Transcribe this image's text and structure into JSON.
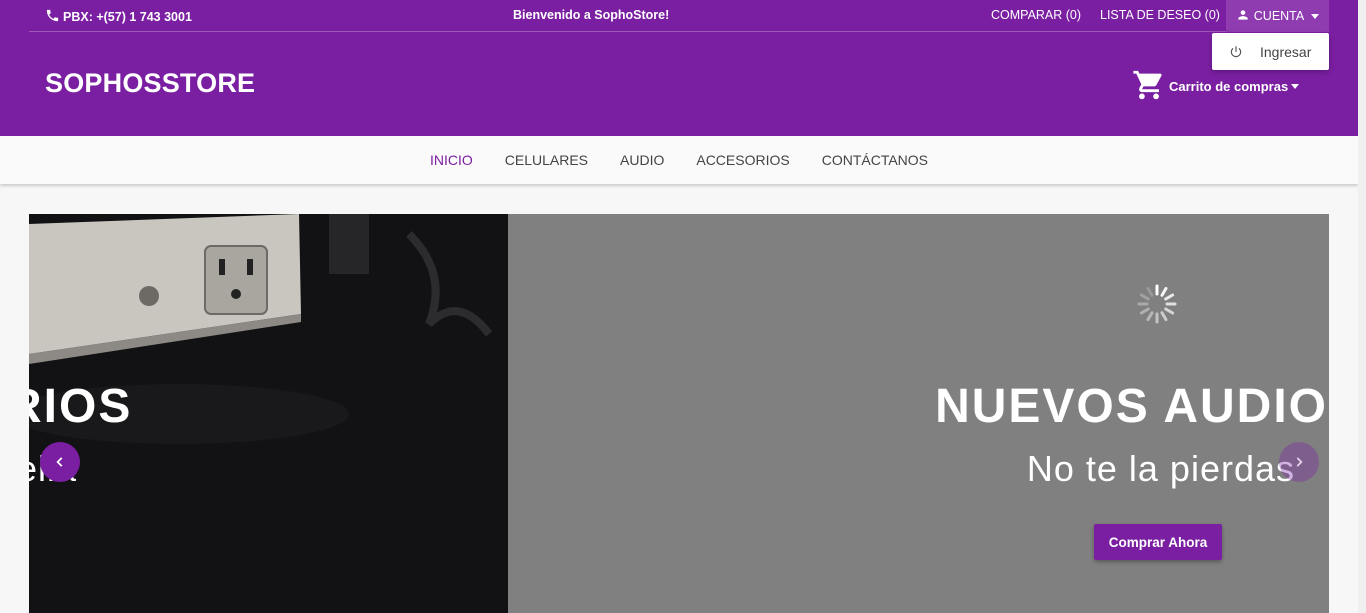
{
  "topbar": {
    "phone": "PBX: +(57) 1 743 3001",
    "welcome": "Bienvenido a SophoStore!",
    "compare": "COMPARAR (0)",
    "wishlist": "LISTA DE DESEO (0)",
    "account": "CUENTA"
  },
  "dropdown": {
    "login": "Ingresar"
  },
  "logo": "SOPHOSSTORE",
  "cart": {
    "label": "Carrito de compras"
  },
  "nav": {
    "items": [
      {
        "label": "INICIO"
      },
      {
        "label": "CELULARES"
      },
      {
        "label": "AUDIO"
      },
      {
        "label": "ACCESORIOS"
      },
      {
        "label": "CONTÁCTANOS"
      }
    ]
  },
  "slides": {
    "left": {
      "title": "RIOS",
      "subtitle": "ella"
    },
    "right": {
      "title": "NUEVOS AUDIO",
      "subtitle": "No te la pierdas",
      "cta": "Comprar Ahora"
    }
  },
  "colors": {
    "brand": "#7b1fa2",
    "slide_gray": "#808080"
  }
}
